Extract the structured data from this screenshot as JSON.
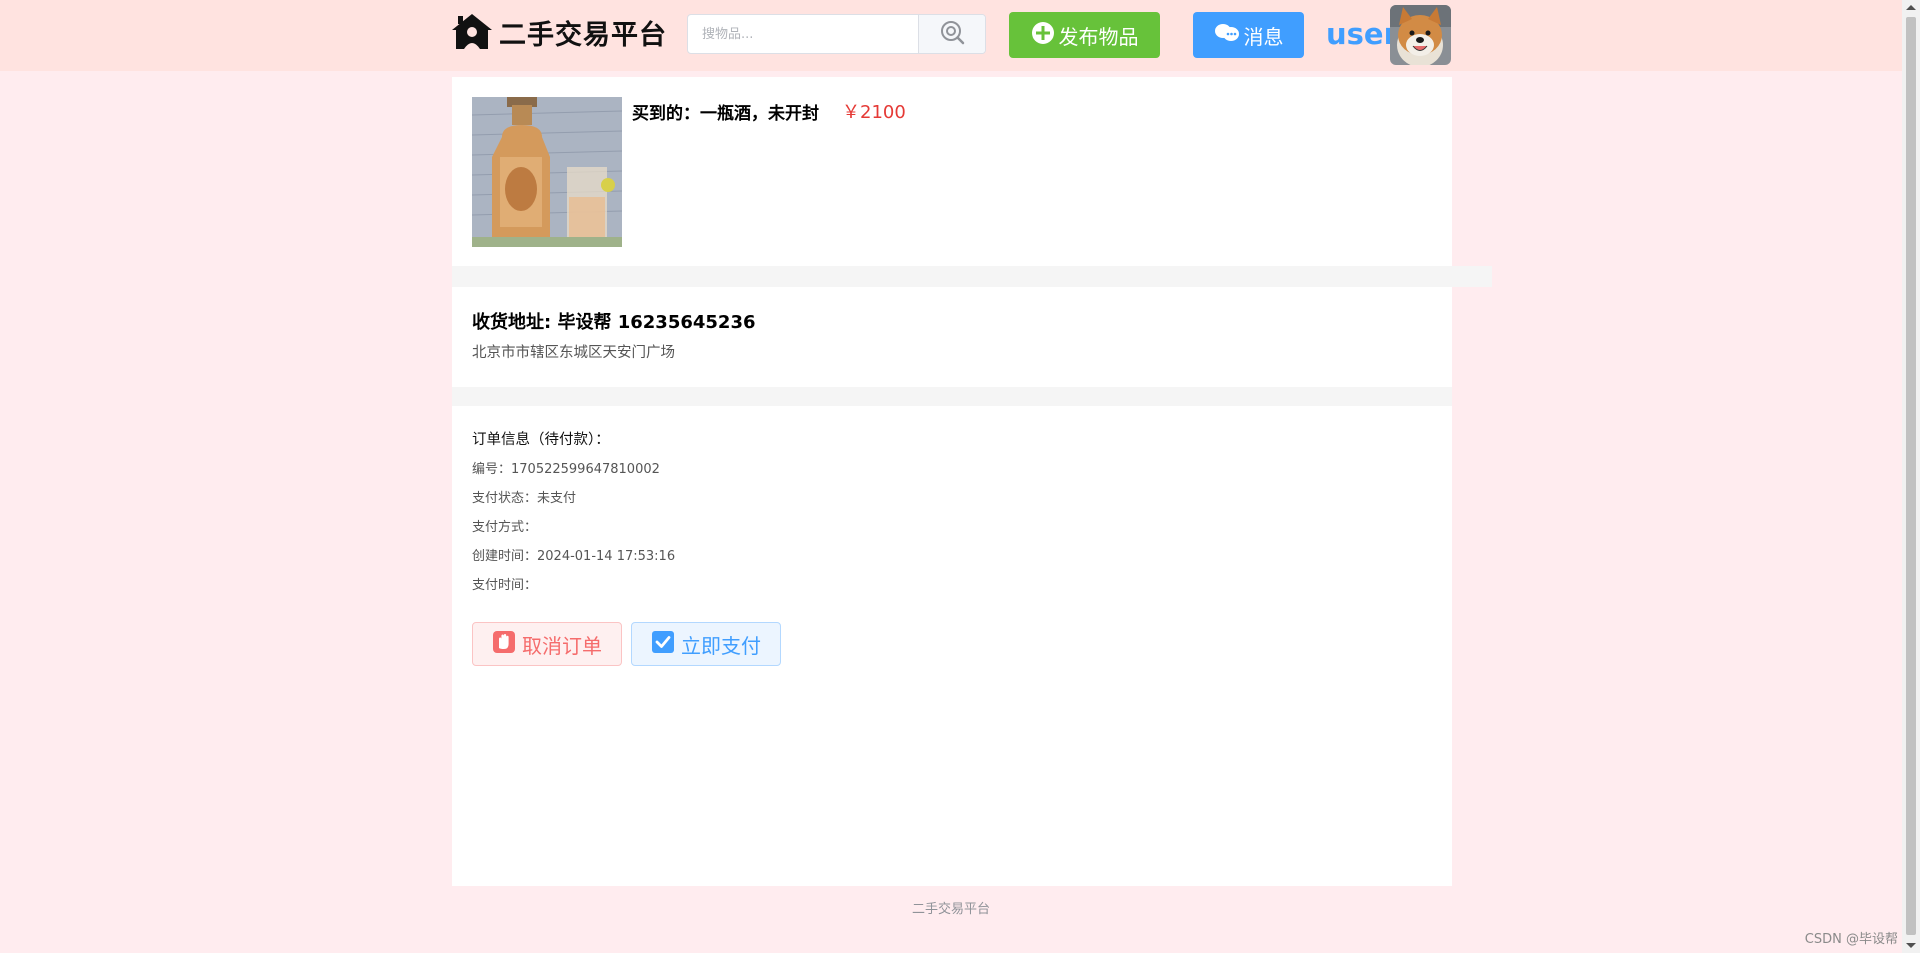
{
  "header": {
    "logo_text": "二手交易平台",
    "search": {
      "placeholder": "搜物品...",
      "value": ""
    },
    "publish_label": "发布物品",
    "message_label": "消息",
    "username": "user"
  },
  "product": {
    "title": "买到的：一瓶酒，未开封",
    "price": "￥2100"
  },
  "address": {
    "header": "收货地址: 毕设帮 16235645236",
    "detail": "北京市市辖区东城区天安门广场"
  },
  "order": {
    "heading": "订单信息（待付款）：",
    "rows": [
      {
        "label": "编号：",
        "value": "170522599647810002"
      },
      {
        "label": "支付状态：",
        "value": "未支付"
      },
      {
        "label": "支付方式：",
        "value": ""
      },
      {
        "label": "创建时间：",
        "value": "2024-01-14 17:53:16"
      },
      {
        "label": "支付时间：",
        "value": ""
      }
    ],
    "cancel_label": "取消订单",
    "pay_label": "立即支付"
  },
  "footer": {
    "text": "二手交易平台"
  },
  "watermark": "CSDN @毕设帮",
  "colors": {
    "header_bg": "#ffe3e0",
    "page_bg": "#ffecef",
    "publish": "#67c23a",
    "message": "#409eff",
    "price": "#e53935",
    "danger": "#f56c6c"
  },
  "icons": {
    "logo": "house-icon",
    "search": "search-icon",
    "publish": "plus-circle-icon",
    "message": "chat-bubbles-icon",
    "cancel": "hand-stop-icon",
    "pay": "checkbox-icon"
  }
}
